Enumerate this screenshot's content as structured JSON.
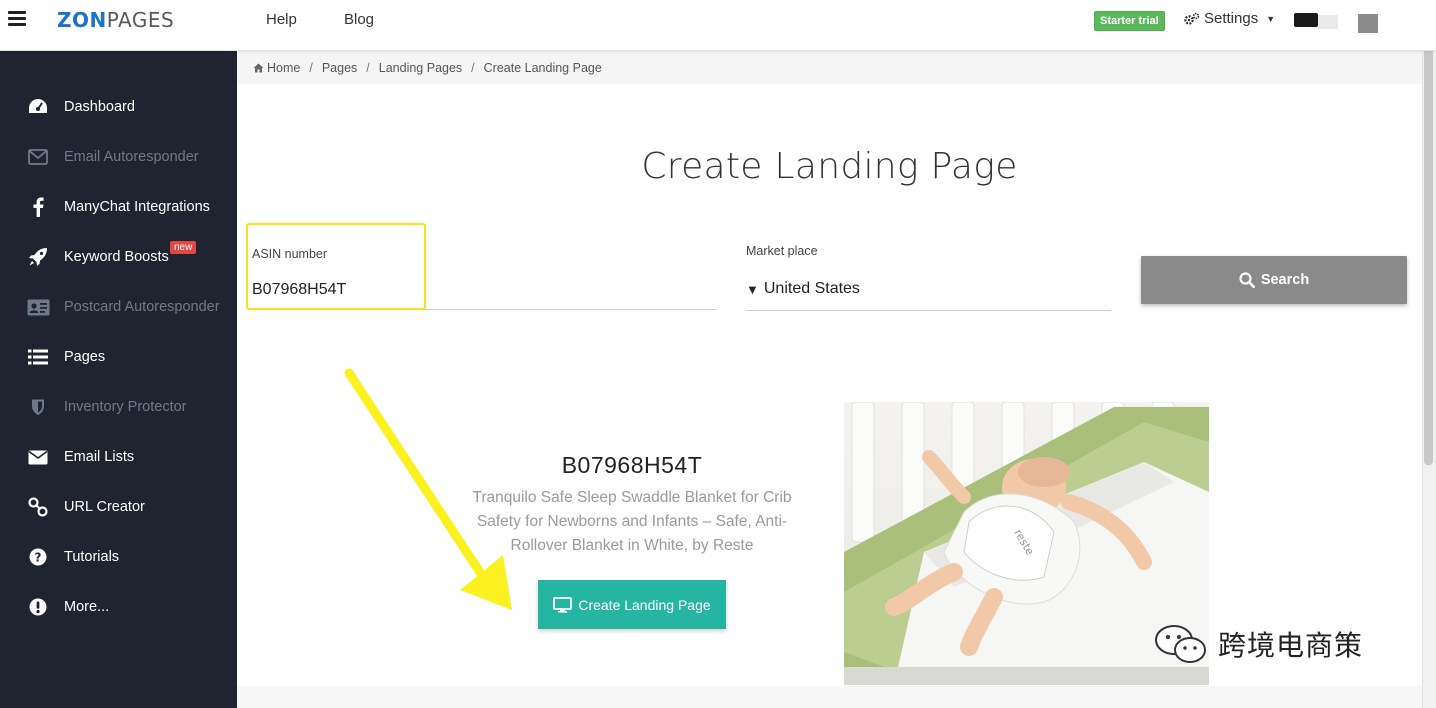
{
  "topbar": {
    "logo_zon": "ZON",
    "logo_pages": "PAGES",
    "help": "Help",
    "blog": "Blog",
    "trial_badge": "Starter trial",
    "settings": "Settings"
  },
  "sidebar": {
    "items": [
      {
        "label": "Dashboard",
        "icon": "dashboard-icon"
      },
      {
        "label": "Email Autoresponder",
        "icon": "envelope-outline-icon"
      },
      {
        "label": "ManyChat Integrations",
        "icon": "facebook-icon"
      },
      {
        "label": "Keyword Boosts",
        "icon": "rocket-icon",
        "badge": "new"
      },
      {
        "label": "Postcard Autoresponder",
        "icon": "id-card-icon"
      },
      {
        "label": "Pages",
        "icon": "list-icon"
      },
      {
        "label": "Inventory Protector",
        "icon": "shield-icon"
      },
      {
        "label": "Email Lists",
        "icon": "envelope-icon"
      },
      {
        "label": "URL Creator",
        "icon": "link-icon"
      },
      {
        "label": "Tutorials",
        "icon": "question-circle-icon"
      },
      {
        "label": "More...",
        "icon": "exclamation-circle-icon"
      }
    ]
  },
  "breadcrumb": [
    "Home",
    "Pages",
    "Landing Pages",
    "Create Landing Page"
  ],
  "main": {
    "title": "Create Landing Page",
    "asin_label": "ASIN number",
    "asin_value": "B07968H54T",
    "market_label": "Market place",
    "market_value": "United States",
    "search_label": "Search"
  },
  "result": {
    "asin": "B07968H54T",
    "description": "Tranquilo Safe Sleep Swaddle Blanket for Crib Safety for Newborns and Infants – Safe, Anti-Rollover Blanket in White, by Reste",
    "create_label": "Create Landing Page"
  },
  "watermark": "跨境电商策",
  "colors": {
    "sidebar_bg": "#1f2430",
    "accent_teal": "#26b5a3",
    "search_gray": "#8a8a8a",
    "trial_green": "#5cb85c",
    "highlight_yellow": "#f7e21b",
    "new_red": "#e04848"
  }
}
